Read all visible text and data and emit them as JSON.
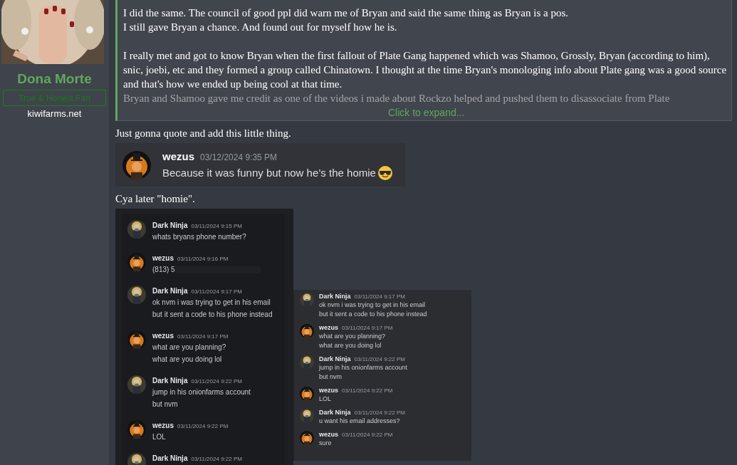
{
  "user": {
    "name": "Dona Morte",
    "title": "True & Honest Fan",
    "site": "kiwifarms.net"
  },
  "quote": {
    "paragraphs": [
      {
        "lines": [
          {
            "text": "I did the same. The council of good ppl did warn me of Bryan and said the same thing as Bryan is a pos.",
            "faded": false
          },
          {
            "text": "I still gave Bryan a chance. And found out for myself how he is.",
            "faded": false
          }
        ]
      },
      {
        "lines": [
          {
            "text": "I really met and got to know Bryan when the first fallout of Plate Gang happened which was Shamoo, Grossly, Bryan (according to him), snic, joebi, etc and they formed a group called Chinatown. I thought at the time Bryan's monologing info about Plate gang was a good source and that's how we ended up being cool at that time.",
            "faded": false
          },
          {
            "text": "Bryan and Shamoo gave me credit as one of the videos i made about Rockzo helped and pushed them to disassociate from Plate",
            "faded": true
          }
        ]
      }
    ],
    "expand": "Click to expand..."
  },
  "text_1": "Just gonna quote and add this little thing.",
  "embed": {
    "author": "wezus",
    "time": "03/12/2024 9:35 PM",
    "text": "Because it was funny but now he’s the homie"
  },
  "text_2": "Cya later \"homie\".",
  "screenshots": [
    {
      "messages": [
        {
          "kind": "ninja",
          "author": "Dark Ninja",
          "time": "03/11/2024 9:15 PM",
          "lines": [
            "whats bryans phone number?"
          ]
        },
        {
          "kind": "wezus",
          "author": "wezus",
          "time": "03/11/2024 9:16 PM",
          "lines": [
            "(813) 5"
          ],
          "redacted": true
        },
        {
          "kind": "ninja",
          "author": "Dark Ninja",
          "time": "03/11/2024 9:17 PM",
          "lines": [
            "ok nvm i was trying to get in his email",
            "but it sent a code to his phone instead"
          ]
        },
        {
          "kind": "wezus",
          "author": "wezus",
          "time": "03/11/2024 9:17 PM",
          "lines": [
            "what are you planning?",
            "what are you doing lol"
          ]
        },
        {
          "kind": "ninja",
          "author": "Dark Ninja",
          "time": "03/11/2024 9:22 PM",
          "lines": [
            "jump in his onionfarms account",
            "but nvm"
          ]
        },
        {
          "kind": "wezus",
          "author": "wezus",
          "time": "03/11/2024 9:22 PM",
          "lines": [
            "LOL"
          ]
        },
        {
          "kind": "ninja",
          "author": "Dark Ninja",
          "time": "03/11/2024 9:22 PM"
        }
      ]
    },
    {
      "messages": [
        {
          "kind": "ninja",
          "author": "Dark Ninja",
          "time": "03/11/2024 9:17 PM",
          "lines": [
            "ok nvm i was trying to get in his email",
            "but it sent a code to his phone instead"
          ]
        },
        {
          "kind": "wezus",
          "author": "wezus",
          "time": "03/11/2024 9:17 PM",
          "lines": [
            "what are you planning?",
            "what are you doing lol"
          ]
        },
        {
          "kind": "ninja",
          "author": "Dark Ninja",
          "time": "03/11/2024 9:22 PM",
          "lines": [
            "jump in his onionfarms account",
            "but nvm"
          ]
        },
        {
          "kind": "wezus",
          "author": "wezus",
          "time": "03/11/2024 9:22 PM",
          "lines": [
            "LOL"
          ]
        },
        {
          "kind": "ninja",
          "author": "Dark Ninja",
          "time": "03/11/2024 9:22 PM",
          "lines": [
            "u want his email addresses?"
          ]
        },
        {
          "kind": "wezus",
          "author": "wezus",
          "time": "03/11/2024 9:22 PM",
          "lines": [
            "sure"
          ]
        }
      ]
    }
  ]
}
